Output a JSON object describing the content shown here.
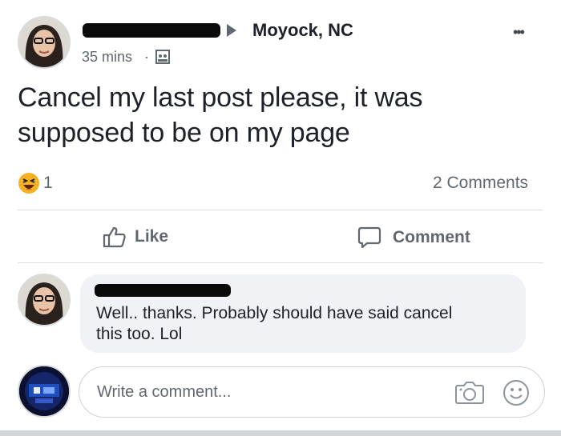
{
  "post": {
    "location": "Moyock, NC",
    "time": "35 mins",
    "separator": "·",
    "text_line1": "Cancel my last post please, it was",
    "text_line2": "supposed to be on my page",
    "reaction_count": "1",
    "comments_count": "2 Comments",
    "more": "•••"
  },
  "actions": {
    "like": "Like",
    "comment": "Comment"
  },
  "comment": {
    "line1": "Well.. thanks. Probably should have said cancel",
    "line2": "this  too. Lol"
  },
  "composer": {
    "placeholder": "Write a comment..."
  },
  "colors": {
    "text": "#1d2129",
    "muted": "#606770",
    "bubble": "#f0f2f5",
    "reaction": "#f7b125"
  },
  "icons": [
    "privacy-icon",
    "haha-reaction-icon",
    "like-icon",
    "comment-icon",
    "camera-icon",
    "emoji-icon",
    "more-icon",
    "triangle-right-icon"
  ]
}
